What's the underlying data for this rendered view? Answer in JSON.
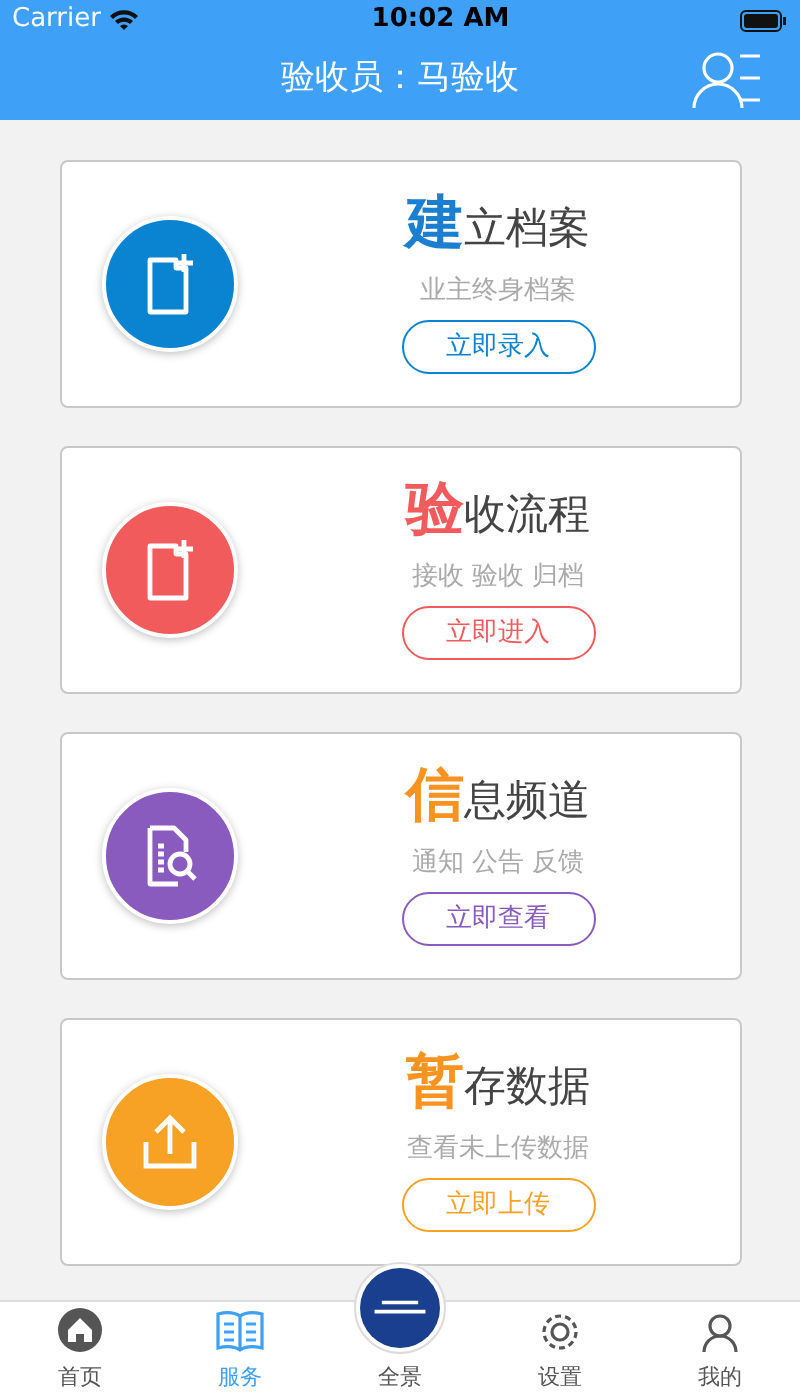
{
  "status_bar": {
    "carrier": "Carrier",
    "time": "10:02 AM"
  },
  "nav_bar": {
    "title": "验收员：马验收"
  },
  "cards": [
    {
      "kind": "file-add",
      "title": {
        "initial": "建",
        "rest": "立档案",
        "color": "#1a7fd0"
      },
      "color": "#0a84d0",
      "subtitle": "业主终身档案",
      "button": "立即录入"
    },
    {
      "kind": "file-add",
      "title": {
        "initial": "验",
        "rest": "收流程",
        "color": "#f25b5b"
      },
      "color": "#f25b5b",
      "subtitle": "接收 验收 归档",
      "button": "立即进入"
    },
    {
      "kind": "doc-search",
      "title": {
        "initial": "信",
        "rest": "息频道",
        "color": "#f7931e"
      },
      "color": "#8a5bbf",
      "subtitle": "通知 公告 反馈",
      "button": "立即查看"
    },
    {
      "kind": "upload",
      "title": {
        "initial": "暂",
        "rest": "存数据",
        "color": "#f7931e"
      },
      "color": "#f7a125",
      "subtitle": "查看未上传数据",
      "button": "立即上传"
    }
  ],
  "tab_bar": [
    {
      "kind": "home",
      "label": "首页",
      "selected": false
    },
    {
      "kind": "book",
      "label": "服务",
      "selected": true
    },
    {
      "kind": "logo",
      "label": "全景",
      "selected": false
    },
    {
      "kind": "gear",
      "label": "设置",
      "selected": false
    },
    {
      "kind": "person",
      "label": "我的",
      "selected": false
    }
  ]
}
